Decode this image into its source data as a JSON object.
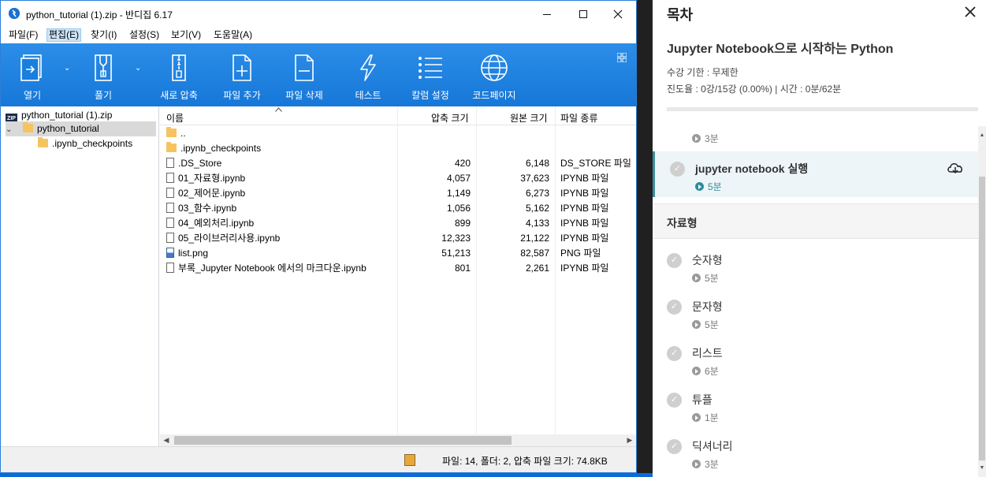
{
  "bandizip": {
    "title": "python_tutorial (1).zip - 반디집 6.17",
    "app_icon_glyph": "⬤",
    "menu": [
      "파일(F)",
      "편집(E)",
      "찾기(I)",
      "설정(S)",
      "보기(V)",
      "도움말(A)"
    ],
    "active_menu_index": 1,
    "toolbar": [
      {
        "label": "열기",
        "icon": "open-icon"
      },
      {
        "label": "풀기",
        "icon": "extract-icon"
      },
      {
        "label": "새로 압축",
        "icon": "new-archive-icon"
      },
      {
        "label": "파일 추가",
        "icon": "add-file-icon"
      },
      {
        "label": "파일 삭제",
        "icon": "delete-file-icon"
      },
      {
        "label": "테스트",
        "icon": "test-icon"
      },
      {
        "label": "칼럼 설정",
        "icon": "column-settings-icon"
      },
      {
        "label": "코드페이지",
        "icon": "codepage-icon"
      }
    ],
    "tree": {
      "root": "python_tutorial (1).zip",
      "folder": "python_tutorial",
      "subfolder": ".ipynb_checkpoints",
      "zip_badge": "ZIP"
    },
    "columns": {
      "name": "이름",
      "compressed": "압축 크기",
      "original": "원본 크기",
      "type": "파일 종류"
    },
    "files": [
      {
        "name": "..",
        "compressed": "",
        "original": "",
        "type": "",
        "kind": "folder"
      },
      {
        "name": ".ipynb_checkpoints",
        "compressed": "",
        "original": "",
        "type": "",
        "kind": "folder"
      },
      {
        "name": ".DS_Store",
        "compressed": "420",
        "original": "6,148",
        "type": "DS_STORE 파일",
        "kind": "doc"
      },
      {
        "name": "01_자료형.ipynb",
        "compressed": "4,057",
        "original": "37,623",
        "type": "IPYNB 파일",
        "kind": "doc"
      },
      {
        "name": "02_제어문.ipynb",
        "compressed": "1,149",
        "original": "6,273",
        "type": "IPYNB 파일",
        "kind": "doc"
      },
      {
        "name": "03_함수.ipynb",
        "compressed": "1,056",
        "original": "5,162",
        "type": "IPYNB 파일",
        "kind": "doc"
      },
      {
        "name": "04_예외처리.ipynb",
        "compressed": "899",
        "original": "4,133",
        "type": "IPYNB 파일",
        "kind": "doc"
      },
      {
        "name": "05_라이브러리사용.ipynb",
        "compressed": "12,323",
        "original": "21,122",
        "type": "IPYNB 파일",
        "kind": "doc"
      },
      {
        "name": "list.png",
        "compressed": "51,213",
        "original": "82,587",
        "type": "PNG 파일",
        "kind": "image"
      },
      {
        "name": "부록_Jupyter Notebook 에서의 마크다운.ipynb",
        "compressed": "801",
        "original": "2,261",
        "type": "IPYNB 파일",
        "kind": "doc"
      }
    ],
    "status": "파일: 14, 폴더: 2, 압축 파일 크기: 74.8KB"
  },
  "toc": {
    "title": "목차",
    "close_glyph": "✕",
    "course_title": "Jupyter Notebook으로 시작하는 Python",
    "deadline": "수강 기한 : 무제한",
    "progress_text": "진도율 : 0강/15강 (0.00%) | 시간 : 0분/62분",
    "progress_fraction": 0.0,
    "check_glyph": "✓",
    "lessons_top": [
      {
        "title": "",
        "duration": "3분",
        "current": false
      },
      {
        "title": "jupyter notebook 실행",
        "duration": "5분",
        "current": true
      }
    ],
    "section": "자료형",
    "lessons": [
      {
        "title": "숫자형",
        "duration": "5분"
      },
      {
        "title": "문자형",
        "duration": "5분"
      },
      {
        "title": "리스트",
        "duration": "6분"
      },
      {
        "title": "튜플",
        "duration": "1분"
      },
      {
        "title": "딕셔너리",
        "duration": "3분"
      }
    ]
  }
}
